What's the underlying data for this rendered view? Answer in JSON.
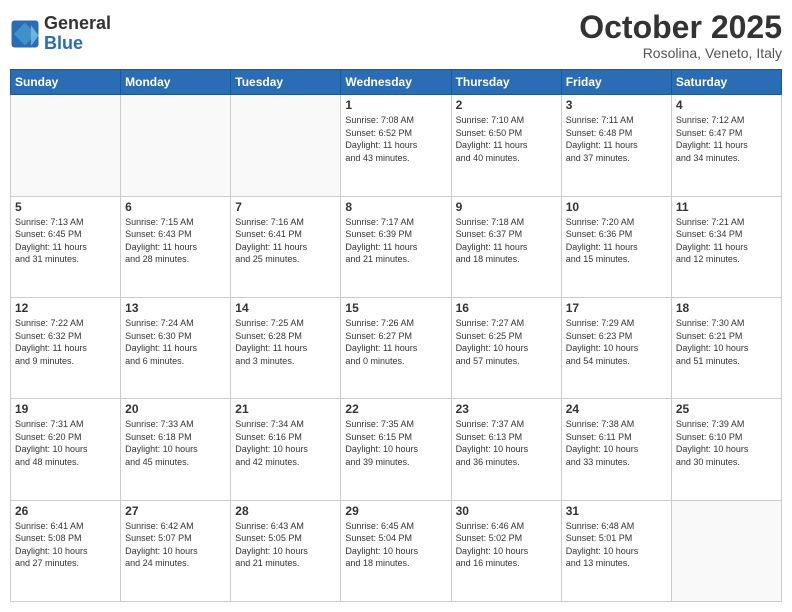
{
  "header": {
    "logo_line1": "General",
    "logo_line2": "Blue",
    "month": "October 2025",
    "location": "Rosolina, Veneto, Italy"
  },
  "days_of_week": [
    "Sunday",
    "Monday",
    "Tuesday",
    "Wednesday",
    "Thursday",
    "Friday",
    "Saturday"
  ],
  "weeks": [
    [
      {
        "day": "",
        "info": ""
      },
      {
        "day": "",
        "info": ""
      },
      {
        "day": "",
        "info": ""
      },
      {
        "day": "1",
        "info": "Sunrise: 7:08 AM\nSunset: 6:52 PM\nDaylight: 11 hours\nand 43 minutes."
      },
      {
        "day": "2",
        "info": "Sunrise: 7:10 AM\nSunset: 6:50 PM\nDaylight: 11 hours\nand 40 minutes."
      },
      {
        "day": "3",
        "info": "Sunrise: 7:11 AM\nSunset: 6:48 PM\nDaylight: 11 hours\nand 37 minutes."
      },
      {
        "day": "4",
        "info": "Sunrise: 7:12 AM\nSunset: 6:47 PM\nDaylight: 11 hours\nand 34 minutes."
      }
    ],
    [
      {
        "day": "5",
        "info": "Sunrise: 7:13 AM\nSunset: 6:45 PM\nDaylight: 11 hours\nand 31 minutes."
      },
      {
        "day": "6",
        "info": "Sunrise: 7:15 AM\nSunset: 6:43 PM\nDaylight: 11 hours\nand 28 minutes."
      },
      {
        "day": "7",
        "info": "Sunrise: 7:16 AM\nSunset: 6:41 PM\nDaylight: 11 hours\nand 25 minutes."
      },
      {
        "day": "8",
        "info": "Sunrise: 7:17 AM\nSunset: 6:39 PM\nDaylight: 11 hours\nand 21 minutes."
      },
      {
        "day": "9",
        "info": "Sunrise: 7:18 AM\nSunset: 6:37 PM\nDaylight: 11 hours\nand 18 minutes."
      },
      {
        "day": "10",
        "info": "Sunrise: 7:20 AM\nSunset: 6:36 PM\nDaylight: 11 hours\nand 15 minutes."
      },
      {
        "day": "11",
        "info": "Sunrise: 7:21 AM\nSunset: 6:34 PM\nDaylight: 11 hours\nand 12 minutes."
      }
    ],
    [
      {
        "day": "12",
        "info": "Sunrise: 7:22 AM\nSunset: 6:32 PM\nDaylight: 11 hours\nand 9 minutes."
      },
      {
        "day": "13",
        "info": "Sunrise: 7:24 AM\nSunset: 6:30 PM\nDaylight: 11 hours\nand 6 minutes."
      },
      {
        "day": "14",
        "info": "Sunrise: 7:25 AM\nSunset: 6:28 PM\nDaylight: 11 hours\nand 3 minutes."
      },
      {
        "day": "15",
        "info": "Sunrise: 7:26 AM\nSunset: 6:27 PM\nDaylight: 11 hours\nand 0 minutes."
      },
      {
        "day": "16",
        "info": "Sunrise: 7:27 AM\nSunset: 6:25 PM\nDaylight: 10 hours\nand 57 minutes."
      },
      {
        "day": "17",
        "info": "Sunrise: 7:29 AM\nSunset: 6:23 PM\nDaylight: 10 hours\nand 54 minutes."
      },
      {
        "day": "18",
        "info": "Sunrise: 7:30 AM\nSunset: 6:21 PM\nDaylight: 10 hours\nand 51 minutes."
      }
    ],
    [
      {
        "day": "19",
        "info": "Sunrise: 7:31 AM\nSunset: 6:20 PM\nDaylight: 10 hours\nand 48 minutes."
      },
      {
        "day": "20",
        "info": "Sunrise: 7:33 AM\nSunset: 6:18 PM\nDaylight: 10 hours\nand 45 minutes."
      },
      {
        "day": "21",
        "info": "Sunrise: 7:34 AM\nSunset: 6:16 PM\nDaylight: 10 hours\nand 42 minutes."
      },
      {
        "day": "22",
        "info": "Sunrise: 7:35 AM\nSunset: 6:15 PM\nDaylight: 10 hours\nand 39 minutes."
      },
      {
        "day": "23",
        "info": "Sunrise: 7:37 AM\nSunset: 6:13 PM\nDaylight: 10 hours\nand 36 minutes."
      },
      {
        "day": "24",
        "info": "Sunrise: 7:38 AM\nSunset: 6:11 PM\nDaylight: 10 hours\nand 33 minutes."
      },
      {
        "day": "25",
        "info": "Sunrise: 7:39 AM\nSunset: 6:10 PM\nDaylight: 10 hours\nand 30 minutes."
      }
    ],
    [
      {
        "day": "26",
        "info": "Sunrise: 6:41 AM\nSunset: 5:08 PM\nDaylight: 10 hours\nand 27 minutes."
      },
      {
        "day": "27",
        "info": "Sunrise: 6:42 AM\nSunset: 5:07 PM\nDaylight: 10 hours\nand 24 minutes."
      },
      {
        "day": "28",
        "info": "Sunrise: 6:43 AM\nSunset: 5:05 PM\nDaylight: 10 hours\nand 21 minutes."
      },
      {
        "day": "29",
        "info": "Sunrise: 6:45 AM\nSunset: 5:04 PM\nDaylight: 10 hours\nand 18 minutes."
      },
      {
        "day": "30",
        "info": "Sunrise: 6:46 AM\nSunset: 5:02 PM\nDaylight: 10 hours\nand 16 minutes."
      },
      {
        "day": "31",
        "info": "Sunrise: 6:48 AM\nSunset: 5:01 PM\nDaylight: 10 hours\nand 13 minutes."
      },
      {
        "day": "",
        "info": ""
      }
    ]
  ]
}
